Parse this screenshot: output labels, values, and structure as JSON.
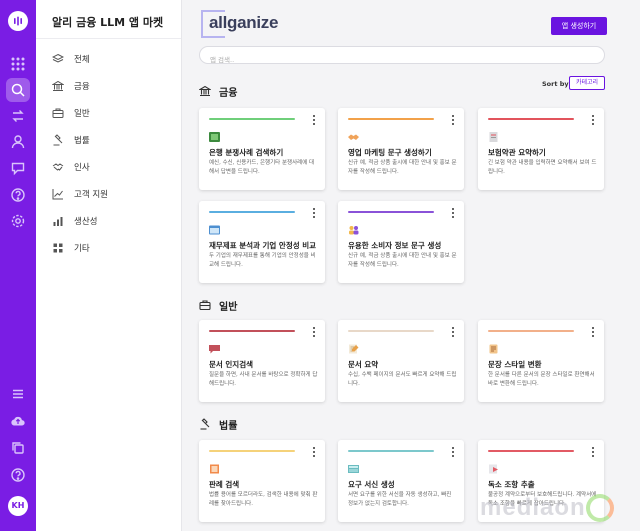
{
  "app": {
    "title": "알리 금융 LLM 앱 마켓",
    "brand_name": "allganize",
    "user_initials": "KH"
  },
  "colors": {
    "primary": "#6a14e0",
    "rail": "#7a1de4"
  },
  "rail": {
    "icons": [
      "logo-icon",
      "apps-grid-icon",
      "app-market-icon",
      "swap-icon",
      "users-icon",
      "chat-icon",
      "help-icon",
      "settings-icon",
      "menu-icon",
      "cloud-upload-icon",
      "copy-icon",
      "help-circle-icon"
    ]
  },
  "sidebar": {
    "items": [
      {
        "label": "전체",
        "icon": "layers-icon"
      },
      {
        "label": "금융",
        "icon": "bank-icon"
      },
      {
        "label": "일반",
        "icon": "briefcase-icon"
      },
      {
        "label": "법률",
        "icon": "gavel-icon"
      },
      {
        "label": "인사",
        "icon": "handshake-icon"
      },
      {
        "label": "고객 지원",
        "icon": "trend-chart-icon"
      },
      {
        "label": "생산성",
        "icon": "bar-chart-icon"
      },
      {
        "label": "기타",
        "icon": "grid-icon"
      }
    ]
  },
  "toolbar": {
    "create_label": "앱 생성하기",
    "search_placeholder": "앱 검색..",
    "sort_label": "Sort by:",
    "sort_value": "카테고리"
  },
  "sections": [
    {
      "title": "금융",
      "icon": "bank-icon",
      "cards": [
        {
          "title": "은행 분쟁사례 검색하기",
          "desc": "예신, 수신, 신용카드, 은행기타 분쟁사례에 대해서 답변을 드립니다.",
          "accent": "#6fcf7a",
          "icon": "green-square-icon"
        },
        {
          "title": "영업 마케팅 문구 생성하기",
          "desc": "신규 예, 적금 상품 출시에 대한 안내 및 홍보 문자를 작성해 드립니다.",
          "accent": "#f2a14a",
          "icon": "handshake-icon"
        },
        {
          "title": "보험약관 요약하기",
          "desc": "긴 보험 약관 내용을 입력하면 요약해서 보여 드립니다.",
          "accent": "#e2545c",
          "icon": "document-icon"
        },
        {
          "title": "재무제표 분석과 기업 안정성 비교",
          "desc": "두 기업의 재무제표를 통해 기업의 안정성을 비교해 드립니다.",
          "accent": "#5aaee0",
          "icon": "browser-window-icon"
        },
        {
          "title": "유용한 소비자 정보 문구 생성",
          "desc": "신규 예, 적금 상품 출시에 대한 안내 및 홍보 문자를 작성해 드립니다.",
          "accent": "#8a52d8",
          "icon": "people-icon"
        }
      ]
    },
    {
      "title": "일반",
      "icon": "briefcase-icon",
      "cards": [
        {
          "title": "문서 인지검색",
          "desc": "질문을 하면, 사내 문서를 바탕으로 정확하게 답해드립니다.",
          "accent": "#c2505a",
          "icon": "chat-bubble-icon"
        },
        {
          "title": "문서 요약",
          "desc": "수십, 수백 페이지의 문서도 빠르게 요약해 드립니다.",
          "accent": "#e8d8c8",
          "icon": "notepad-icon"
        },
        {
          "title": "문장 스타일 변환",
          "desc": "한 문서를 다른 문서의 문장 스타일로 환연해서 바로 변환해 드립니다.",
          "accent": "#f2b08a",
          "icon": "clipboard-icon"
        }
      ]
    },
    {
      "title": "법률",
      "icon": "gavel-icon",
      "cards": [
        {
          "title": "판례 검색",
          "desc": "법률 용어를 모르더라도, 검색한 내용에 맞춰 판례를 찾아드립니다.",
          "accent": "#f5d27a",
          "icon": "law-book-icon"
        },
        {
          "title": "요구 서신 생성",
          "desc": "서면 요구를 위한 서신을 자동 생성하고, 빠진 정보가 없는지 검토합니다.",
          "accent": "#7cc8cc",
          "icon": "letter-icon"
        },
        {
          "title": "독소 조항 추출",
          "desc": "불공정 계약으로부터 보호해드립니다. 계약서에 독소 조항을 빠르게 잡아드립니다.",
          "accent": "#e25a64",
          "icon": "contract-icon"
        }
      ]
    }
  ],
  "watermark": "mediaon"
}
